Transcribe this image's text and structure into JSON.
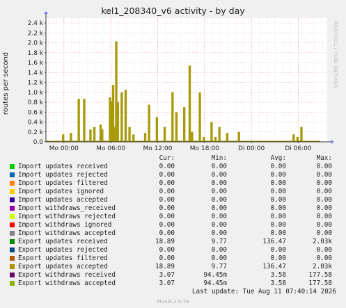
{
  "title": "kel1_208340_v6 activity - by day",
  "ylabel": "routes per second",
  "side_text": "RRDTOOL / TOBI OETIKER",
  "chart_data": {
    "type": "area",
    "yticks": [
      "0.0",
      "0.2 k",
      "0.4 k",
      "0.6 k",
      "0.8 k",
      "1.0 k",
      "1.2 k",
      "1.4 k",
      "1.6 k",
      "1.8 k",
      "2.0 k",
      "2.2 k",
      "2.4 k"
    ],
    "ytick_values": [
      0,
      200,
      400,
      600,
      800,
      1000,
      1200,
      1400,
      1600,
      1800,
      2000,
      2200,
      2400
    ],
    "ylim": [
      0,
      2500
    ],
    "xticks": [
      "Mo 00:00",
      "Mo 06:00",
      "Mo 12:00",
      "Mo 18:00",
      "Di 00:00",
      "Di 06:00"
    ],
    "xtick_hours": [
      0,
      6,
      12,
      18,
      24,
      30
    ],
    "xlim_hours": [
      -2.3,
      33.7
    ],
    "grid": true,
    "series_color": "#a89a0a",
    "x": [
      0.0,
      0.5,
      1.0,
      1.5,
      2.0,
      2.5,
      2.7,
      3.0,
      3.5,
      4.0,
      4.5,
      4.8,
      5.0,
      5.3,
      5.6,
      6.0,
      6.2,
      6.4,
      6.6,
      6.8,
      7.0,
      7.3,
      7.5,
      7.8,
      8.0,
      8.3,
      8.5,
      9.0,
      9.5,
      10.0,
      10.5,
      11.0,
      11.5,
      12.0,
      12.5,
      13.0,
      13.5,
      14.0,
      14.5,
      15.0,
      15.5,
      16.0,
      16.2,
      16.5,
      17.0,
      17.5,
      18.0,
      18.5,
      19.0,
      19.5,
      20.0,
      20.5,
      21.0,
      21.5,
      22.0,
      22.5,
      23.0,
      23.5,
      24.0,
      24.5,
      25.0,
      25.5,
      26.0,
      26.5,
      27.0,
      27.5,
      28.0,
      28.5,
      29.0,
      29.5,
      30.0,
      30.5,
      31.0,
      31.5,
      32.0,
      32.5
    ],
    "y": [
      150,
      0,
      180,
      0,
      870,
      0,
      870,
      0,
      250,
      300,
      0,
      350,
      250,
      0,
      0,
      900,
      820,
      1150,
      300,
      2030,
      800,
      0,
      1000,
      0,
      1050,
      0,
      300,
      150,
      0,
      0,
      180,
      750,
      0,
      500,
      0,
      300,
      0,
      1000,
      600,
      0,
      700,
      0,
      1540,
      200,
      0,
      1000,
      100,
      0,
      400,
      100,
      300,
      0,
      180,
      0,
      0,
      200,
      0,
      0,
      0,
      0,
      0,
      0,
      0,
      0,
      0,
      0,
      0,
      0,
      0,
      150,
      100,
      300,
      0,
      0,
      0,
      0
    ]
  },
  "legend": {
    "headers": {
      "cur": "Cur:",
      "min": "Min:",
      "avg": "Avg:",
      "max": "Max:"
    },
    "rows": [
      {
        "name": "Import updates received",
        "color": "#00cc00",
        "cur": "0.00",
        "min": "0.00",
        "avg": "0.00",
        "max": "0.00"
      },
      {
        "name": "Import updates rejected",
        "color": "#0066b3",
        "cur": "0.00",
        "min": "0.00",
        "avg": "0.00",
        "max": "0.00"
      },
      {
        "name": "Import updates filtered",
        "color": "#ff8000",
        "cur": "0.00",
        "min": "0.00",
        "avg": "0.00",
        "max": "0.00"
      },
      {
        "name": "Import updates ignored",
        "color": "#ffcc00",
        "cur": "0.00",
        "min": "0.00",
        "avg": "0.00",
        "max": "0.00"
      },
      {
        "name": "Import updates accepted",
        "color": "#330099",
        "cur": "0.00",
        "min": "0.00",
        "avg": "0.00",
        "max": "0.00"
      },
      {
        "name": "Import withdraws_received",
        "color": "#990099",
        "cur": "0.00",
        "min": "0.00",
        "avg": "0.00",
        "max": "0.00"
      },
      {
        "name": "Import withdraws rejected",
        "color": "#ccff00",
        "cur": "0.00",
        "min": "0.00",
        "avg": "0.00",
        "max": "0.00"
      },
      {
        "name": "Import withdraws ignored",
        "color": "#ff0000",
        "cur": "0.00",
        "min": "0.00",
        "avg": "0.00",
        "max": "0.00"
      },
      {
        "name": "Import withdraws accepted",
        "color": "#808080",
        "cur": "0.00",
        "min": "0.00",
        "avg": "0.00",
        "max": "0.00"
      },
      {
        "name": "Export updates received",
        "color": "#008f00",
        "cur": "18.89",
        "min": "9.77",
        "avg": "136.47",
        "max": "2.03k"
      },
      {
        "name": "Export updates rejected",
        "color": "#00487d",
        "cur": "0.00",
        "min": "0.00",
        "avg": "0.00",
        "max": "0.00"
      },
      {
        "name": "Export updates filtered",
        "color": "#b35a00",
        "cur": "0.00",
        "min": "0.00",
        "avg": "0.00",
        "max": "0.00"
      },
      {
        "name": "Export updates accepted",
        "color": "#b38f00",
        "cur": "18.89",
        "min": "9.77",
        "avg": "136.47",
        "max": "2.03k"
      },
      {
        "name": "Export withdraws received",
        "color": "#6b006b",
        "cur": "3.07",
        "min": "94.45m",
        "avg": "3.58",
        "max": "177.58"
      },
      {
        "name": "Export withdraws accepted",
        "color": "#8fb300",
        "cur": "3.07",
        "min": "94.45m",
        "avg": "3.58",
        "max": "177.58"
      }
    ]
  },
  "last_update": "Last update: Tue Aug 11 07:40:14 2026",
  "footer": "Munin 2.0.76"
}
